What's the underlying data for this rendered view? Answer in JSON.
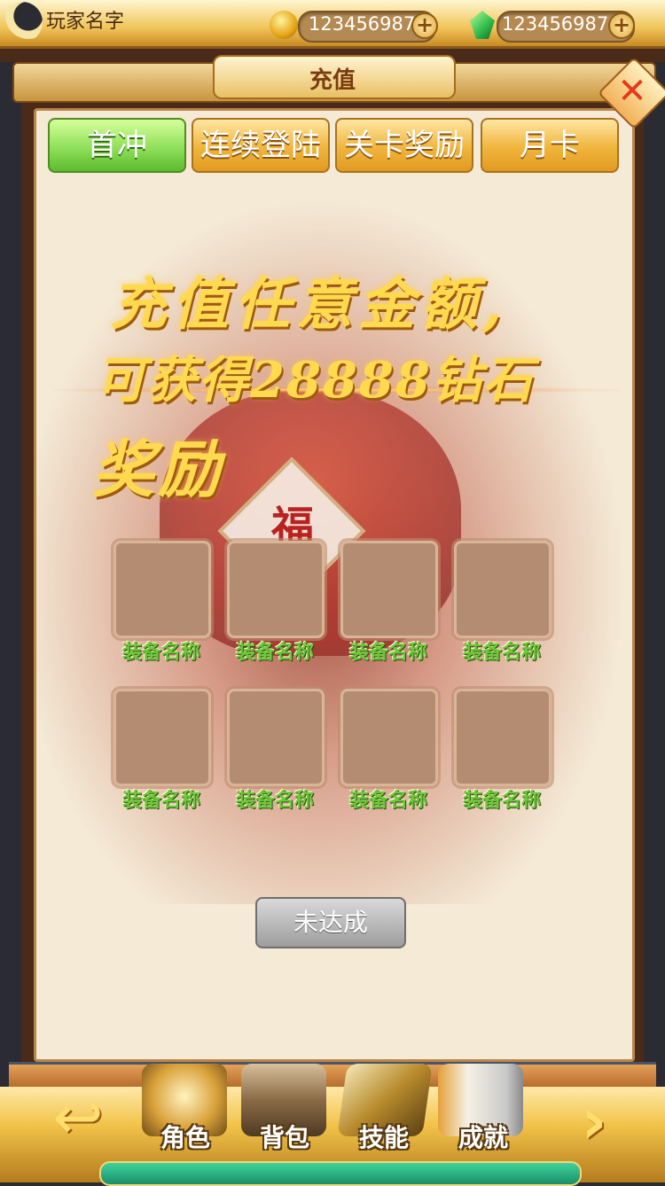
{
  "top_bar": {
    "player_name": "玩家名字",
    "gold_value": "123456987",
    "gem_value": "123456987",
    "plus_label": "+"
  },
  "window": {
    "title": "充值",
    "close_label": "✕"
  },
  "tabs": [
    {
      "label": "首冲",
      "active": true
    },
    {
      "label": "连续登陆",
      "active": false
    },
    {
      "label": "关卡奖励",
      "active": false
    },
    {
      "label": "月卡",
      "active": false
    }
  ],
  "banner": {
    "line1": "充值任意金额,",
    "line2": "可获得28888钻石",
    "line3": "奖励",
    "card_text": "福"
  },
  "rewards": [
    {
      "name": "装备名称"
    },
    {
      "name": "装备名称"
    },
    {
      "name": "装备名称"
    },
    {
      "name": "装备名称"
    },
    {
      "name": "装备名称"
    },
    {
      "name": "装备名称"
    },
    {
      "name": "装备名称"
    },
    {
      "name": "装备名称"
    }
  ],
  "status_button": "未达成",
  "bottom_nav": {
    "back_label": "↩",
    "next_label": "›",
    "items": [
      {
        "label": "角色",
        "icon": "helmet-icon"
      },
      {
        "label": "背包",
        "icon": "chest-icon"
      },
      {
        "label": "技能",
        "icon": "skill-book-icon"
      },
      {
        "label": "成就",
        "icon": "scroll-icon"
      }
    ]
  },
  "colors": {
    "active_tab": "#8fe05a",
    "inactive_tab": "#f0b53c",
    "item_name": "#6fc73a",
    "headline": "#ffd94e"
  }
}
